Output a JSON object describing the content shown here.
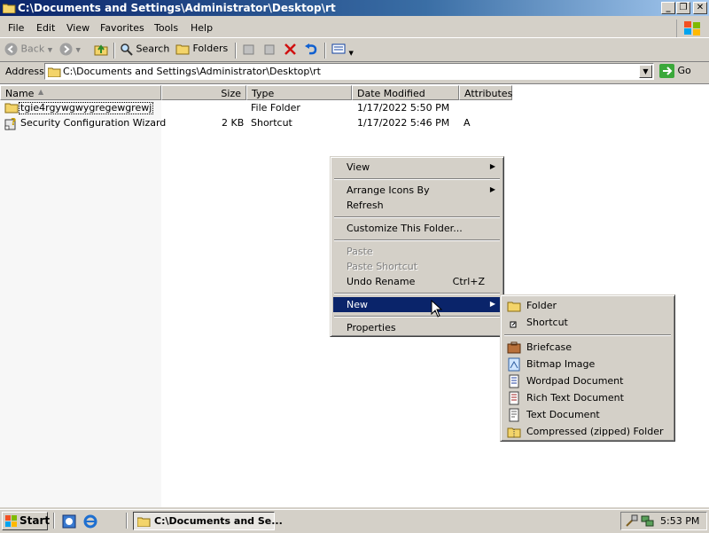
{
  "window": {
    "title": "C:\\Documents and Settings\\Administrator\\Desktop\\rt"
  },
  "menubar": {
    "items": [
      "File",
      "Edit",
      "View",
      "Favorites",
      "Tools",
      "Help"
    ]
  },
  "toolbar": {
    "back": "Back",
    "search": "Search",
    "folders": "Folders"
  },
  "address": {
    "label": "Address",
    "value": "C:\\Documents and Settings\\Administrator\\Desktop\\rt",
    "go": "Go"
  },
  "list": {
    "columns": [
      "Name",
      "Size",
      "Type",
      "Date Modified",
      "Attributes"
    ],
    "rows": [
      {
        "name": "tgie4rgywgwygregewgrewj",
        "size": "",
        "type": "File Folder",
        "date": "1/17/2022 5:50 PM",
        "attr": ""
      },
      {
        "name": "Security Configuration Wizard",
        "size": "2 KB",
        "type": "Shortcut",
        "date": "1/17/2022 5:46 PM",
        "attr": "A"
      }
    ]
  },
  "context_menu": {
    "view": "View",
    "arrange": "Arrange Icons By",
    "refresh": "Refresh",
    "customize": "Customize This Folder...",
    "paste": "Paste",
    "paste_shortcut": "Paste Shortcut",
    "undo_rename": "Undo Rename",
    "undo_accel": "Ctrl+Z",
    "new": "New",
    "properties": "Properties"
  },
  "new_submenu": {
    "folder": "Folder",
    "shortcut": "Shortcut",
    "briefcase": "Briefcase",
    "bitmap": "Bitmap Image",
    "wordpad": "Wordpad Document",
    "rtf": "Rich Text Document",
    "text": "Text Document",
    "zip": "Compressed (zipped) Folder"
  },
  "taskbar": {
    "start": "Start",
    "task": "C:\\Documents and Se...",
    "clock": "5:53 PM"
  },
  "colors": {
    "titlebar": "#0a246a",
    "selection": "#0a246a",
    "face": "#d4d0c8"
  }
}
